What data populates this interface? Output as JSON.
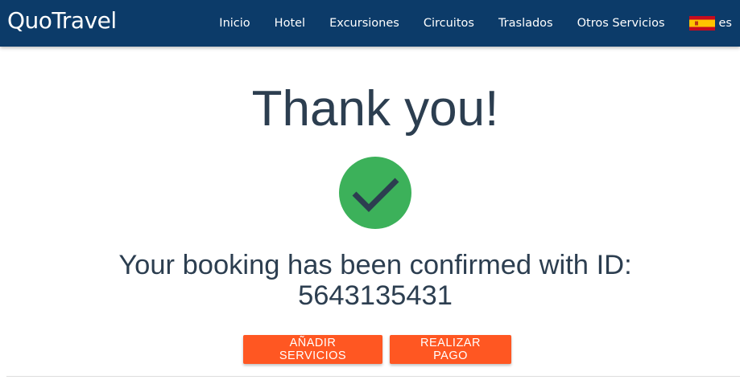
{
  "navbar": {
    "brand": "QuoTravel",
    "background": "#0c3b69",
    "links": [
      {
        "label": "Inicio"
      },
      {
        "label": "Hotel"
      },
      {
        "label": "Excursiones"
      },
      {
        "label": "Circuitos"
      },
      {
        "label": "Traslados"
      },
      {
        "label": "Otros Servicios"
      }
    ],
    "language": {
      "code": "es",
      "flag_icon": "spain-flag-icon"
    }
  },
  "main": {
    "title": "Thank you!",
    "success_icon": "checkmark-circle-icon",
    "success_color": "#3cb15a",
    "confirmation_line1": "Your booking has been confirmed with ID:",
    "booking_id": "5643135431",
    "text_color": "#2c3e50"
  },
  "actions": {
    "add_services_label": "AÑADIR SERVICIOS",
    "make_payment_label": "REALIZAR PAGO",
    "button_color": "#ff5722"
  }
}
